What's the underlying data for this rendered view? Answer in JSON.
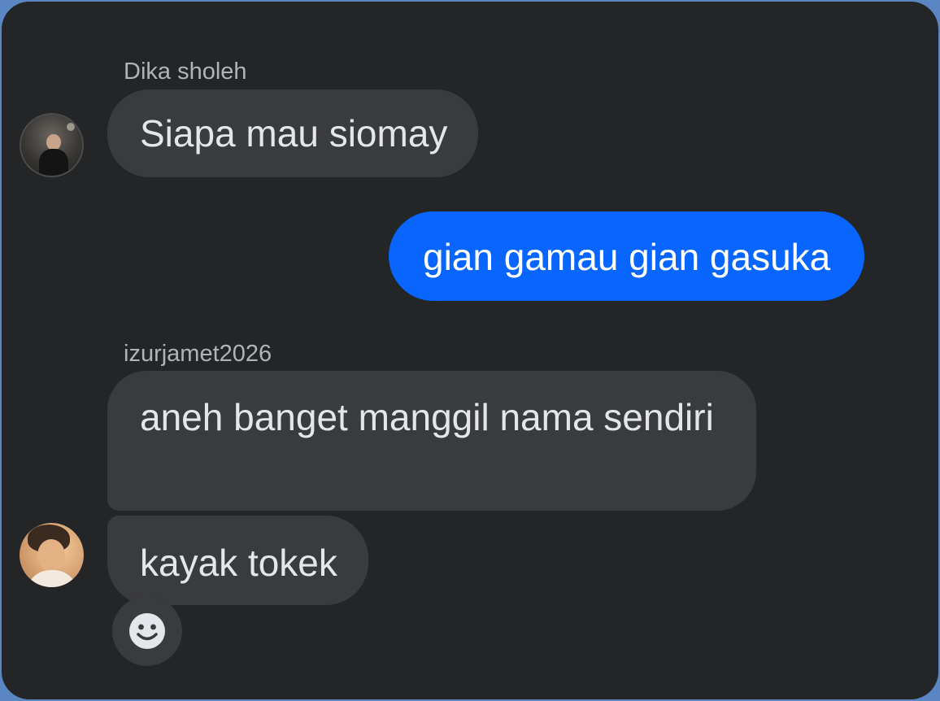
{
  "messages": [
    {
      "sender": "Dika sholeh",
      "text": "Siapa mau siomay",
      "direction": "incoming"
    },
    {
      "text": "gian gamau gian gasuka",
      "direction": "outgoing"
    },
    {
      "sender": "izurjamet2026",
      "text": "aneh banget manggil nama sendiri",
      "direction": "incoming"
    },
    {
      "text": "kayak tokek",
      "direction": "incoming"
    }
  ],
  "icons": {
    "reaction": "smiley-face-icon"
  },
  "colors": {
    "background": "#242526",
    "incoming_bubble": "#3a3b3c",
    "outgoing_bubble": "#0866ff",
    "frame": "#5a86c4"
  }
}
